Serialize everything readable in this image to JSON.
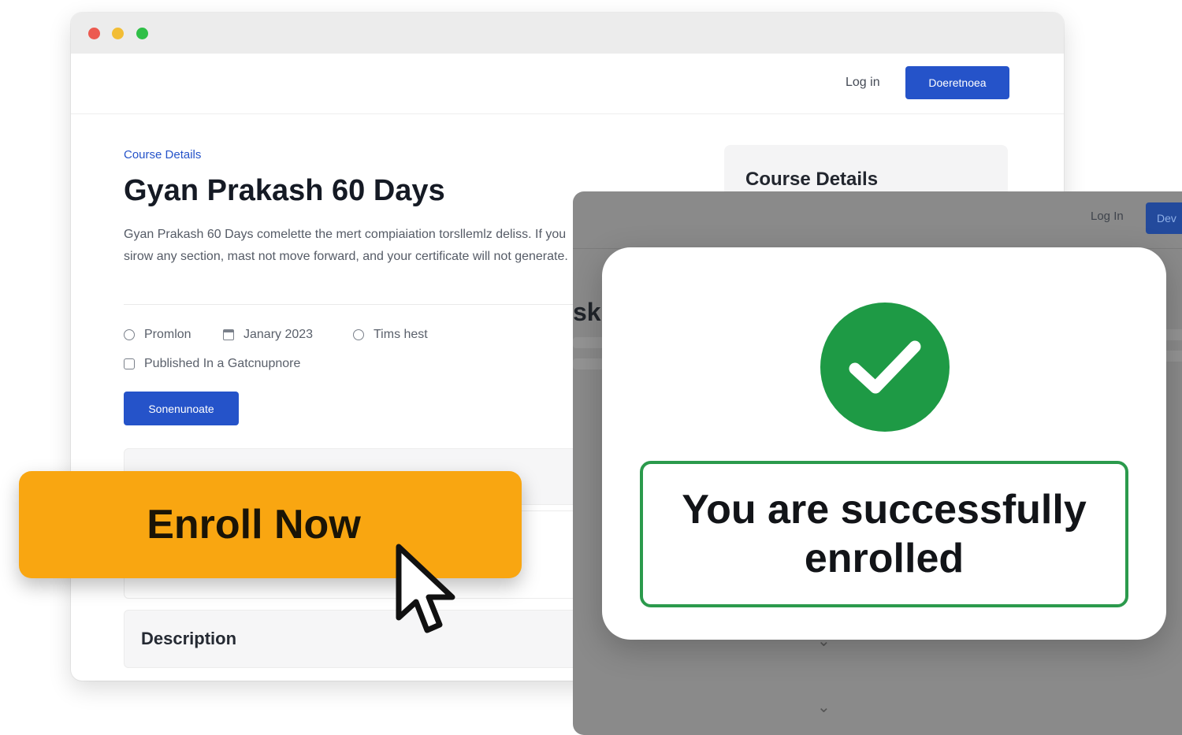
{
  "browser": {
    "nav": {
      "login_label": "Log in",
      "primary_button_label": "Doeretnoea"
    },
    "breadcrumb": "Course Details",
    "title": "Gyan Prakash 60 Days",
    "description": "Gyan Prakash 60 Days comelette the mert compiaiation torsllemlz deliss. If you sirow any section, mast not move forward, and your certificate will not generate.",
    "meta": [
      {
        "icon": "coin-icon",
        "text": "Promlon"
      },
      {
        "icon": "calendar-icon",
        "text": "Janary 2023"
      },
      {
        "icon": "clock-icon",
        "text": "Tims hest"
      },
      {
        "icon": "publish-icon",
        "text": "Published In a Gatcnupnore"
      }
    ],
    "secondary_button_label": "Sonenunoate",
    "description_panel_label": "Description",
    "side_card_label": "Course Details"
  },
  "overlay": {
    "login_label": "Log In",
    "button_fragment": "Dev",
    "text_fragment": "sk"
  },
  "modal": {
    "icon": "check-icon",
    "message": "You are successfully enrolled"
  },
  "enroll": {
    "label": "Enroll Now"
  },
  "colors": {
    "primary_blue": "#2553c9",
    "enroll_orange": "#f9a611",
    "success_green": "#1e9a45"
  }
}
